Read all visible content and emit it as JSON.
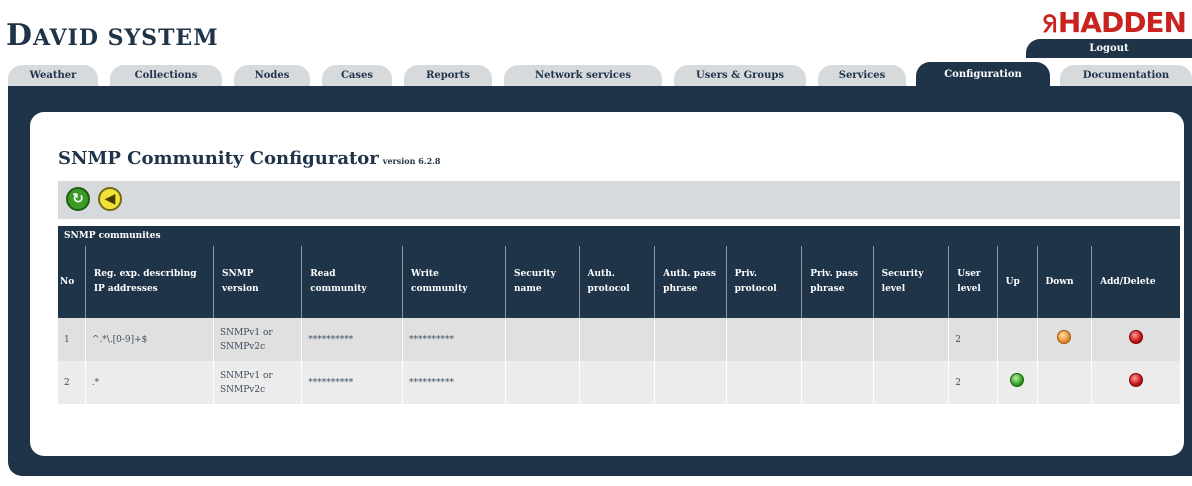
{
  "header": {
    "brand_initial": "D",
    "brand_rest": "AVID SYSTEM",
    "logo_mark": "ᖆ",
    "logo_text": "HADDEN",
    "logout_label": "Logout"
  },
  "tabs": [
    {
      "label": "Weather",
      "active": false
    },
    {
      "label": "Collections",
      "active": false
    },
    {
      "label": "Nodes",
      "active": false
    },
    {
      "label": "Cases",
      "active": false
    },
    {
      "label": "Reports",
      "active": false
    },
    {
      "label": "Network services",
      "active": false
    },
    {
      "label": "Users & Groups",
      "active": false
    },
    {
      "label": "Services",
      "active": false
    },
    {
      "label": "Configuration",
      "active": true
    },
    {
      "label": "Documentation",
      "active": false
    }
  ],
  "page": {
    "title": "SNMP Community Configurator",
    "version": "version 6.2.8"
  },
  "toolbar": {
    "refresh_icon": "refresh-icon",
    "back_icon": "back-icon"
  },
  "table": {
    "caption": "SNMP communites",
    "headers": [
      "No",
      "Reg. exp. describing IP addresses",
      "SNMP version",
      "Read community",
      "Write community",
      "Security name",
      "Auth. protocol",
      "Auth. pass phrase",
      "Priv. protocol",
      "Priv. pass phrase",
      "Security level",
      "User level",
      "Up",
      "Down",
      "Add/Delete"
    ],
    "rows": [
      {
        "no": "1",
        "regexp": "^.*\\.[0-9]+$",
        "version": "SNMPv1 or SNMPv2c",
        "read": "**********",
        "write": "**********",
        "security_name": "",
        "auth_protocol": "",
        "auth_pass": "",
        "priv_protocol": "",
        "priv_pass": "",
        "security_level": "",
        "user_level": "2",
        "up": false,
        "down": true,
        "delete": true
      },
      {
        "no": "2",
        "regexp": ".*",
        "version": "SNMPv1 or SNMPv2c",
        "read": "**********",
        "write": "**********",
        "security_name": "",
        "auth_protocol": "",
        "auth_pass": "",
        "priv_protocol": "",
        "priv_pass": "",
        "security_level": "",
        "user_level": "2",
        "up": true,
        "down": false,
        "delete": true
      }
    ]
  },
  "colors": {
    "navy": "#1f3349",
    "tab_inactive": "#d6dadd",
    "logo_red": "#c8231e"
  }
}
